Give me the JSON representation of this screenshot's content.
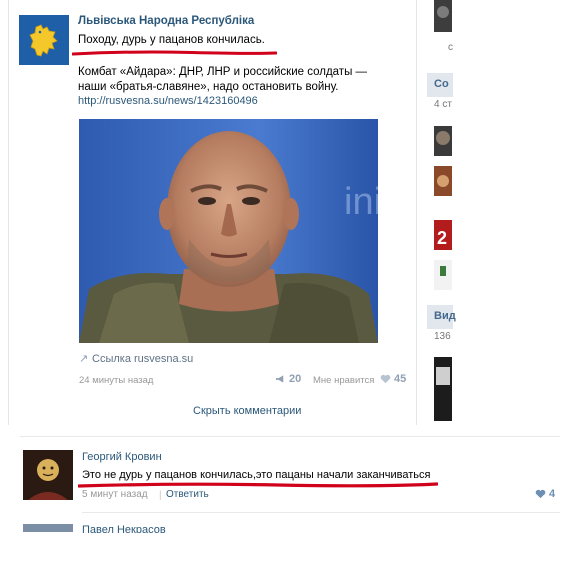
{
  "post": {
    "group_name": "Львівська Народна Республіка",
    "title": "Походу, дурь у пацанов кончилась.",
    "text": "Комбат «Айдара»: ДНР, ЛНР и российские солдаты — наши «братья-славяне», надо остановить войну.",
    "link": "http://rusvesna.su/news/1423160496",
    "attachment_label": "Ссылка rusvesna.su",
    "time": "24 минуты назад",
    "shares": "20",
    "like_label": "Мне нравится",
    "likes": "45",
    "hide_comments": "Скрыть комментарии"
  },
  "sidebar": {
    "header1": "Со",
    "sub1": "4 ст",
    "header2": "Вид",
    "sub2": "136"
  },
  "comment": {
    "author": "Георгий Кровин",
    "text": "Это не дурь у пацанов кончилась,это пацаны начали заканчиваться",
    "time": "5 минут назад",
    "reply": "Ответить",
    "likes": "4"
  },
  "next_comment": {
    "author": "Павел Некрасов"
  },
  "colors": {
    "link": "#2b587a",
    "underline_red": "#d0021b",
    "group_avatar": "#1f5fa8"
  }
}
